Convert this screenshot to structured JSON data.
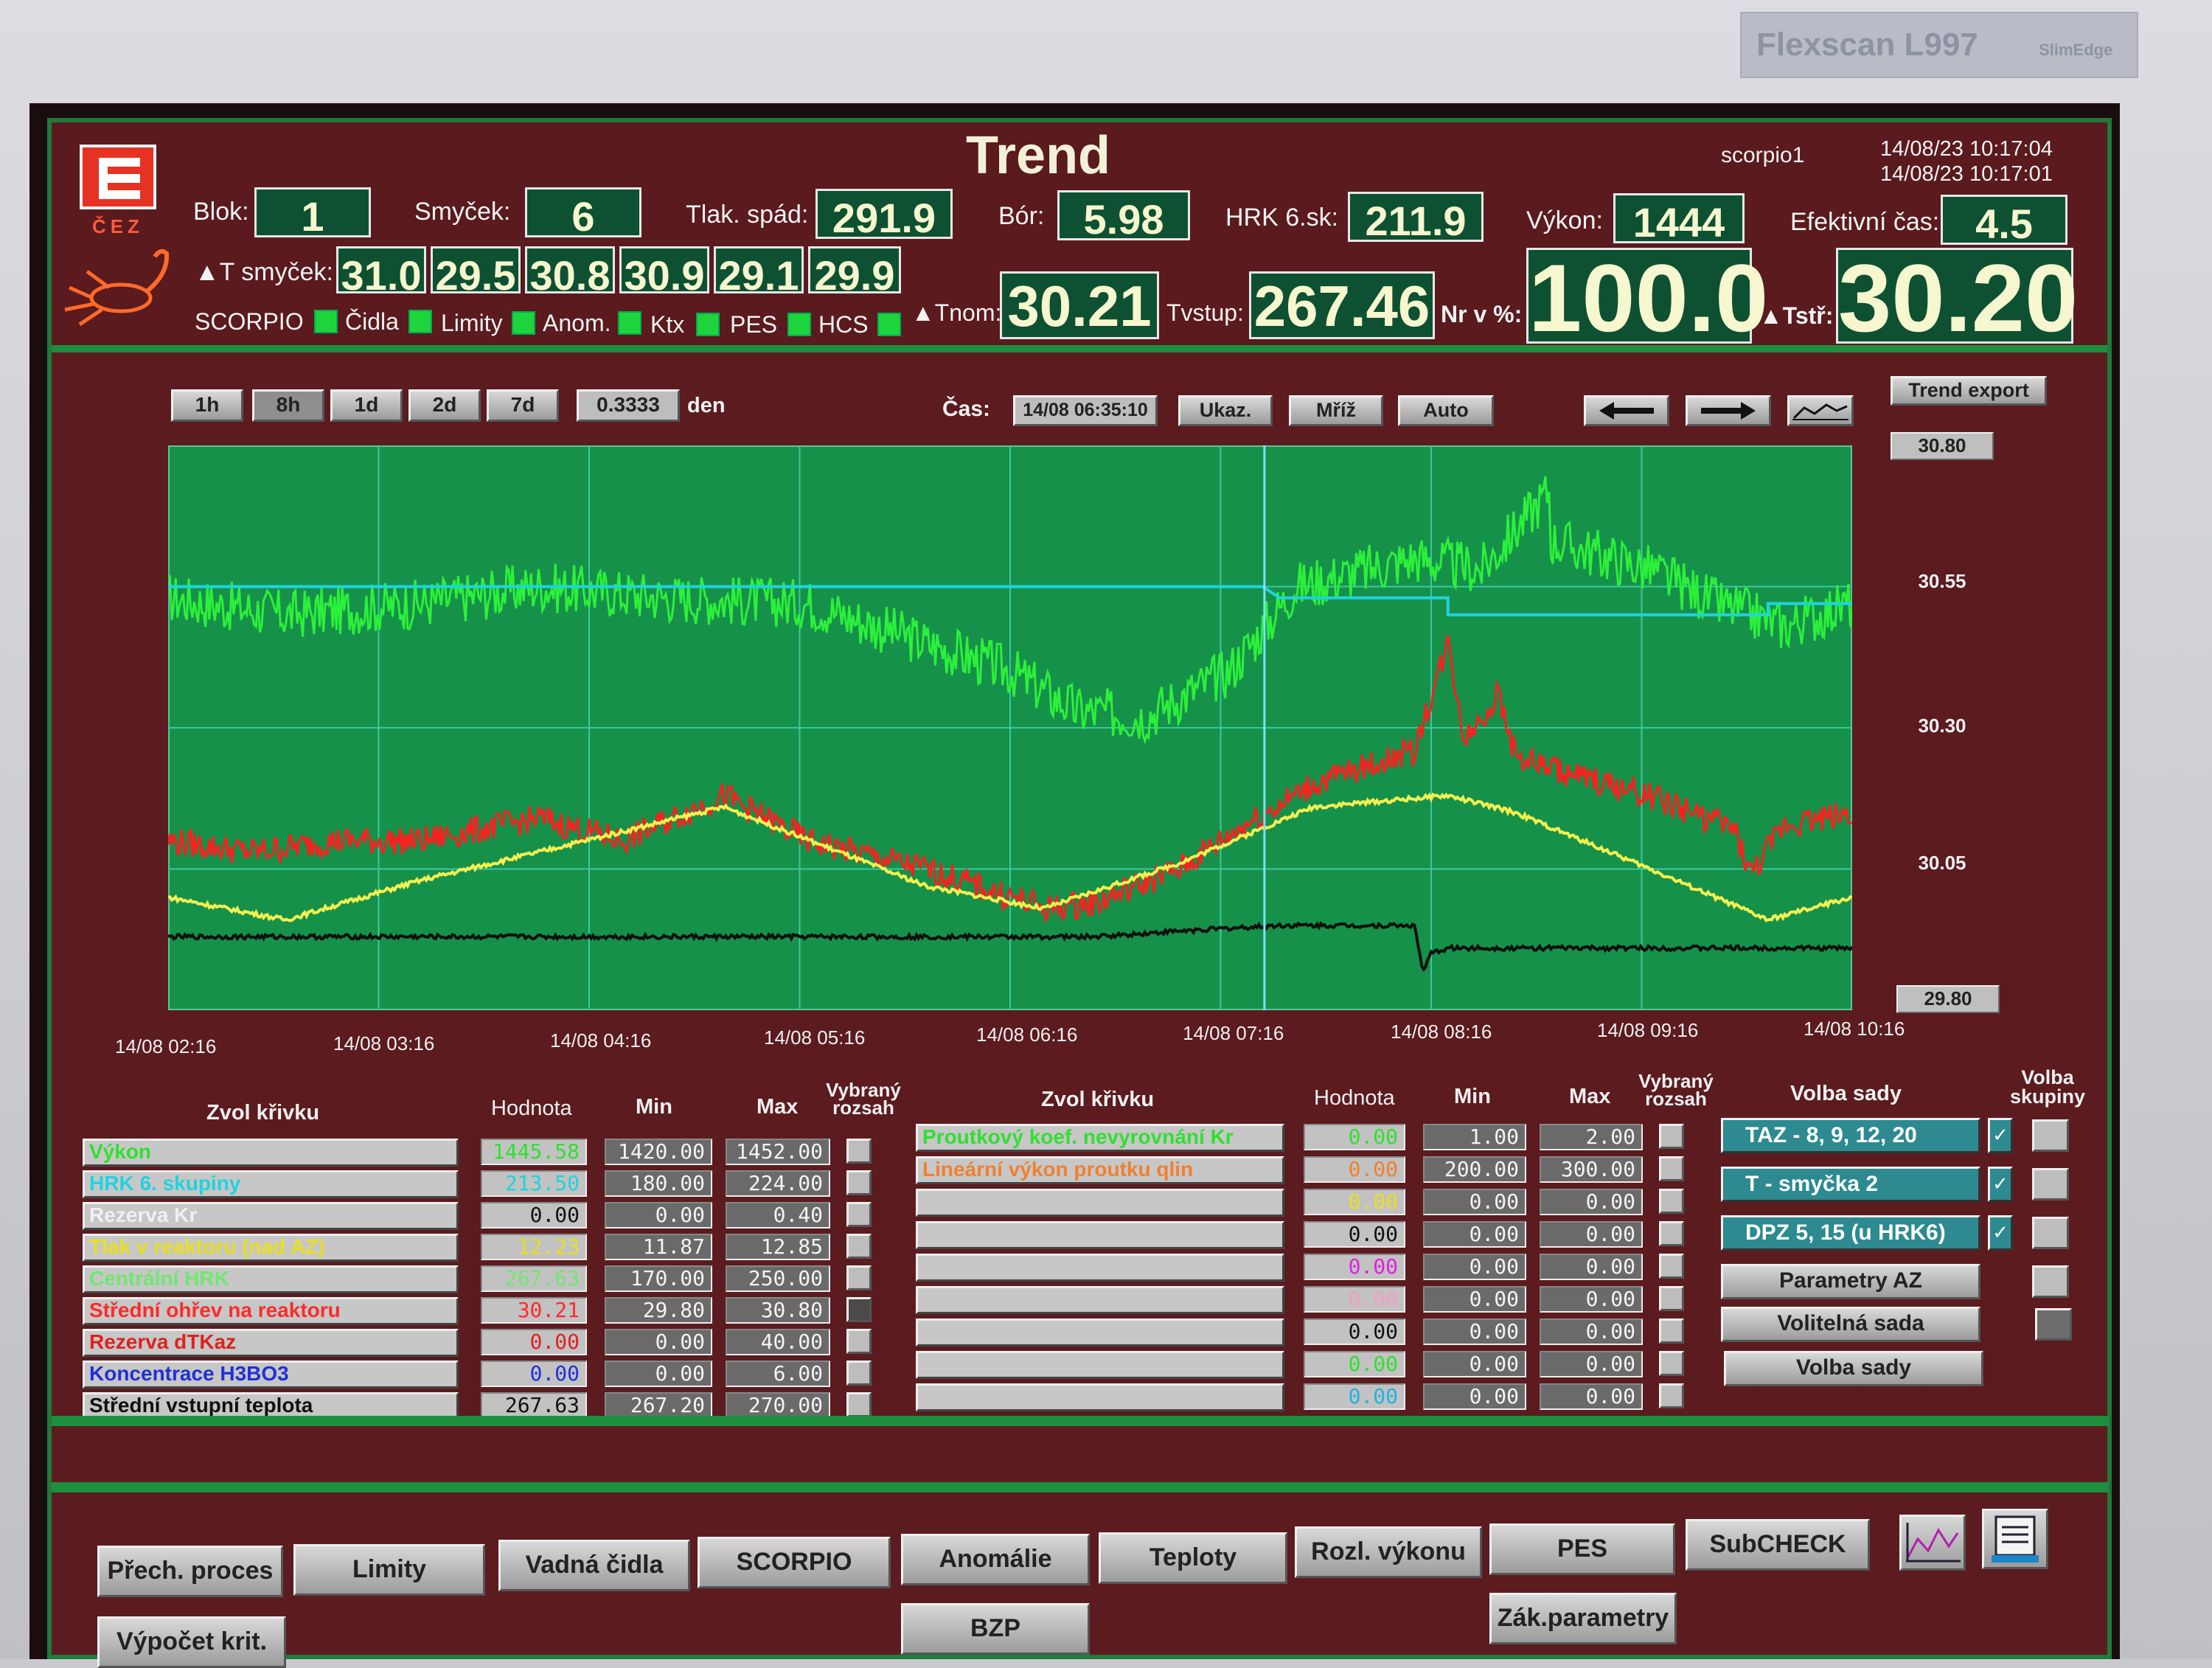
{
  "header": {
    "title": "Trend",
    "host": "scorpio1",
    "datetime1": "14/08/23 10:17:04",
    "datetime2": "14/08/23 10:17:01",
    "logo_text": "ČEZ",
    "blok_label": "Blok:",
    "blok_value": "1",
    "smycek_label": "Smyček:",
    "smycek_value": "6",
    "tlak_label": "Tlak. spád:",
    "tlak_value": "291.9",
    "bor_label": "Bór:",
    "bor_value": "5.98",
    "hrk_label": "HRK 6.sk:",
    "hrk_value": "211.9",
    "vykon_label": "Výkon:",
    "vykon_value": "1444",
    "efekt_label": "Efektivní čas:",
    "efekt_value": "4.5",
    "dT_label": "▲T smyček:",
    "dT_values": [
      "31.0",
      "29.5",
      "30.8",
      "30.9",
      "29.1",
      "29.9"
    ],
    "indicators": [
      "SCORPIO",
      "Čidla",
      "Limity",
      "Anom.",
      "Ktx",
      "PES",
      "HCS"
    ],
    "tnom_label": "▲Tnom:",
    "tnom_value": "30.21",
    "tvstup_label": "Tvstup:",
    "tvstup_value": "267.46",
    "nr_label": "Nr v %:",
    "nr_value": "100.0",
    "tstr_label": "▲Tstř:",
    "tstr_value": "30.20"
  },
  "toolbar": {
    "ranges": [
      "1h",
      "8h",
      "1d",
      "2d",
      "7d"
    ],
    "range_value": "0.3333",
    "range_unit": "den",
    "cas_label": "Čas:",
    "cas_value": "14/08 06:35:10",
    "ukaz": "Ukaz.",
    "mriz": "Mříž",
    "auto": "Auto",
    "trend_export": "Trend export"
  },
  "chart_data": {
    "type": "line",
    "x_ticks": [
      "14/08 02:16",
      "14/08 03:16",
      "14/08 04:16",
      "14/08 05:16",
      "14/08 06:16",
      "14/08 07:16",
      "14/08 08:16",
      "14/08 09:16",
      "14/08 10:16"
    ],
    "y_ticks": [
      "30.80",
      "30.55",
      "30.30",
      "30.05",
      "29.80"
    ],
    "ylim": [
      29.8,
      30.8
    ],
    "grid": true,
    "colors": {
      "bg": "#16914a",
      "grid": "#39c9a0",
      "green": "#2cf03a",
      "cyan": "#1fd3e0",
      "red": "#ff1e1e",
      "yellow": "#f3f050",
      "black": "#101010"
    },
    "series": [
      {
        "x": [
          0,
          0.07,
          0.15,
          0.22,
          0.3,
          0.38,
          0.44,
          0.5,
          0.54,
          0.58,
          0.63,
          0.67,
          0.74,
          0.78,
          0.82,
          0.8,
          0.88,
          0.92,
          0.96,
          1.0
        ],
        "y": [
          30.53,
          30.5,
          30.52,
          30.55,
          30.53,
          30.52,
          30.46,
          30.4,
          30.33,
          30.32,
          30.4,
          30.55,
          30.6,
          30.58,
          30.72,
          30.65,
          30.58,
          30.52,
          30.48,
          30.52
        ]
      },
      {
        "x": [
          0,
          0.65,
          0.66,
          0.76,
          0.76,
          0.95,
          0.95,
          1.0
        ],
        "y": [
          30.55,
          30.55,
          30.53,
          30.53,
          30.5,
          30.5,
          30.52,
          30.52
        ]
      },
      {
        "x": [
          0,
          0.05,
          0.1,
          0.15,
          0.22,
          0.27,
          0.33,
          0.38,
          0.45,
          0.52,
          0.55,
          0.6,
          0.64,
          0.68,
          0.74,
          0.76,
          0.77,
          0.79,
          0.8,
          0.83,
          0.88,
          0.93,
          0.94,
          0.96,
          1.0
        ],
        "y": [
          30.1,
          30.08,
          30.1,
          30.1,
          30.14,
          30.1,
          30.18,
          30.1,
          30.05,
          29.98,
          29.99,
          30.05,
          30.13,
          30.2,
          30.26,
          30.45,
          30.28,
          30.36,
          30.25,
          30.22,
          30.18,
          30.12,
          30.04,
          30.13,
          30.15
        ]
      },
      {
        "x": [
          0,
          0.07,
          0.15,
          0.22,
          0.33,
          0.45,
          0.52,
          0.6,
          0.68,
          0.76,
          0.8,
          0.88,
          0.95,
          1.0
        ],
        "y": [
          30.0,
          29.96,
          30.03,
          30.08,
          30.16,
          30.02,
          29.98,
          30.06,
          30.16,
          30.18,
          30.15,
          30.05,
          29.96,
          30.0
        ]
      },
      {
        "x": [
          0,
          0.3,
          0.55,
          0.6,
          0.66,
          0.7,
          0.74,
          0.745,
          0.75,
          0.76,
          0.8,
          1.0
        ],
        "y": [
          29.93,
          29.93,
          29.93,
          29.94,
          29.95,
          29.95,
          29.95,
          29.87,
          29.9,
          29.91,
          29.91,
          29.91
        ]
      }
    ]
  },
  "table_left": {
    "head_zvol": "Zvol křivku",
    "head_hodnota": "Hodnota",
    "head_min": "Min",
    "head_max": "Max",
    "head_rozsah": "Vybraný rozsah",
    "rows": [
      {
        "name": "Výkon",
        "color": "#30e030",
        "val": "1445.58",
        "min": "1420.00",
        "max": "1452.00"
      },
      {
        "name": "HRK 6. skupiny",
        "color": "#1fd3e0",
        "val": "213.50",
        "min": "180.00",
        "max": "224.00"
      },
      {
        "name": "Rezerva Kr",
        "color": "#f0f0f0",
        "val": "0.00",
        "min": "0.00",
        "max": "0.40"
      },
      {
        "name": "Tlak v reaktoru (nad AZ)",
        "color": "#e8e020",
        "val": "12.23",
        "min": "11.87",
        "max": "12.85"
      },
      {
        "name": "Centrální HRK",
        "color": "#6fe86f",
        "val": "267.63",
        "min": "170.00",
        "max": "250.00"
      },
      {
        "name": "Střední ohřev na reaktoru",
        "color": "#ff2a2a",
        "val": "30.21",
        "min": "29.80",
        "max": "30.80"
      },
      {
        "name": "Rezerva dTKaz",
        "color": "#e02020",
        "val": "0.00",
        "min": "0.00",
        "max": "40.00"
      },
      {
        "name": "Koncentrace H3BO3",
        "color": "#2030d8",
        "val": "0.00",
        "min": "0.00",
        "max": "6.00"
      },
      {
        "name": "Střední vstupní teplota",
        "color": "#101010",
        "val": "267.63",
        "min": "267.20",
        "max": "270.00"
      }
    ]
  },
  "table_right": {
    "head_zvol": "Zvol křivku",
    "head_hodnota": "Hodnota",
    "head_min": "Min",
    "head_max": "Max",
    "head_rozsah": "Vybraný rozsah",
    "rows": [
      {
        "name": "Proutkový koef. nevyrovnání Kr",
        "color": "#30e030",
        "val": "0.00",
        "min": "1.00",
        "max": "2.00"
      },
      {
        "name": "Lineární výkon proutku qlin",
        "color": "#f08030",
        "val": "0.00",
        "min": "200.00",
        "max": "300.00"
      },
      {
        "name": "",
        "color": "#e8e020",
        "val": "0.00",
        "min": "0.00",
        "max": "0.00"
      },
      {
        "name": "",
        "color": "#101010",
        "val": "0.00",
        "min": "0.00",
        "max": "0.00"
      },
      {
        "name": "",
        "color": "#e020e0",
        "val": "0.00",
        "min": "0.00",
        "max": "0.00"
      },
      {
        "name": "",
        "color": "#f0a0c0",
        "val": "0.00",
        "min": "0.00",
        "max": "0.00"
      },
      {
        "name": "",
        "color": "#101010",
        "val": "0.00",
        "min": "0.00",
        "max": "0.00"
      },
      {
        "name": "",
        "color": "#30e030",
        "val": "0.00",
        "min": "0.00",
        "max": "0.00"
      },
      {
        "name": "",
        "color": "#1fb3e0",
        "val": "0.00",
        "min": "0.00",
        "max": "0.00"
      }
    ]
  },
  "volba": {
    "head_sady": "Volba sady",
    "head_skupiny": "Volba skupiny",
    "sets": [
      "TAZ - 8, 9, 12, 20",
      "T - smyčka 2",
      "DPZ 5, 15 (u HRK6)"
    ],
    "buttons": [
      "Parametry AZ",
      "Volitelná sada",
      "Volba sady"
    ]
  },
  "bottom": {
    "row1": [
      "Přech. proces",
      "Limity",
      "Vadná čidla",
      "SCORPIO",
      "Anomálie",
      "Teploty",
      "Rozl. výkonu",
      "PES",
      "SubCHECK"
    ],
    "row2": [
      "Výpočet krit.",
      "BZP",
      "Zák.parametry"
    ]
  },
  "bezel": {
    "brand": "Flexscan L997",
    "badge": "SlimEdge"
  }
}
